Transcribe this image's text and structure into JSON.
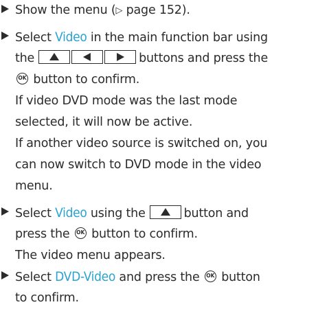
{
  "steps": [
    {
      "lines": {
        "l1_pre": "Show the menu (",
        "ref_icon": "▷",
        "l1_post": " page 152)."
      }
    },
    {
      "lines": {
        "l1_pre": "Select ",
        "l1_kw": "Video",
        "l1_post": " in the main function bar using",
        "l2_pre": "the",
        "l2_post": "buttons and press the",
        "l3_ok": "OK",
        "l3_post": " button to confirm."
      },
      "notes": [
        {
          "l1": "If video DVD mode was the last mode",
          "l2": "selected, it will now be active."
        },
        {
          "l1": "If another video source is switched on, you",
          "l2": "can now switch to DVD mode in the video",
          "l3": "menu."
        }
      ]
    },
    {
      "lines": {
        "l1_pre": "Select ",
        "l1_kw": "Video",
        "l1_mid": " using the",
        "l1_post": "button and",
        "l2_pre": "press the ",
        "l2_ok": "OK",
        "l2_post": " button to confirm.",
        "l3": "The video menu appears."
      }
    },
    {
      "lines": {
        "l1_pre": "Select ",
        "l1_kw": "DVD-Video",
        "l1_mid": " and press the ",
        "l1_ok": "OK",
        "l1_post": " button",
        "l2": "to confirm."
      }
    }
  ],
  "icons": {
    "bullet": "triangle-right-bullet-icon",
    "up": "up-arrow-key-icon",
    "left": "left-arrow-key-icon",
    "right": "right-arrow-key-icon",
    "ok": "ok-button-icon",
    "ref": "page-reference-icon"
  },
  "colors": {
    "keyword": "#2aa3cf",
    "text": "#2b2b2b"
  }
}
